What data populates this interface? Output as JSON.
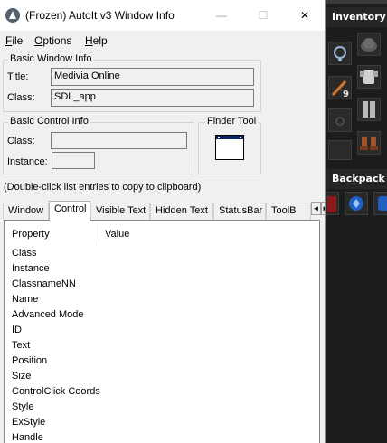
{
  "window": {
    "title": "(Frozen) AutoIt v3 Window Info",
    "controls": {
      "minimize": "—",
      "maximize": "☐",
      "close": "✕"
    }
  },
  "menu": [
    "File",
    "Options",
    "Help"
  ],
  "basic_window_info": {
    "group_label": "Basic Window Info",
    "title_label": "Title:",
    "title_value": "Medivia Online",
    "class_label": "Class:",
    "class_value": "SDL_app"
  },
  "basic_control_info": {
    "group_label": "Basic Control Info",
    "class_label": "Class:",
    "class_value": "",
    "instance_label": "Instance:",
    "instance_value": ""
  },
  "finder_tool": {
    "group_label": "Finder Tool"
  },
  "hint": "(Double-click list entries to copy to clipboard)",
  "tabs": [
    "Window",
    "Control",
    "Visible Text",
    "Hidden Text",
    "StatusBar",
    "ToolB"
  ],
  "active_tab": "Control",
  "tab_scroll": {
    "left": "◄",
    "right": "►"
  },
  "list": {
    "columns": [
      "Property",
      "Value"
    ],
    "rows": [
      "Class",
      "Instance",
      "ClassnameNN",
      "Name",
      "Advanced Mode",
      "ID",
      "Text",
      "Position",
      "Size",
      "ControlClick Coords",
      "Style",
      "ExStyle",
      "Handle"
    ]
  },
  "game_panel": {
    "inventory_label": "Inventory",
    "backpack_label": "Backpack",
    "ammo_count": "9",
    "colors": {
      "panel": "#1c1c1c",
      "header": "#262626",
      "blue_item": "#1e5fbf"
    }
  }
}
